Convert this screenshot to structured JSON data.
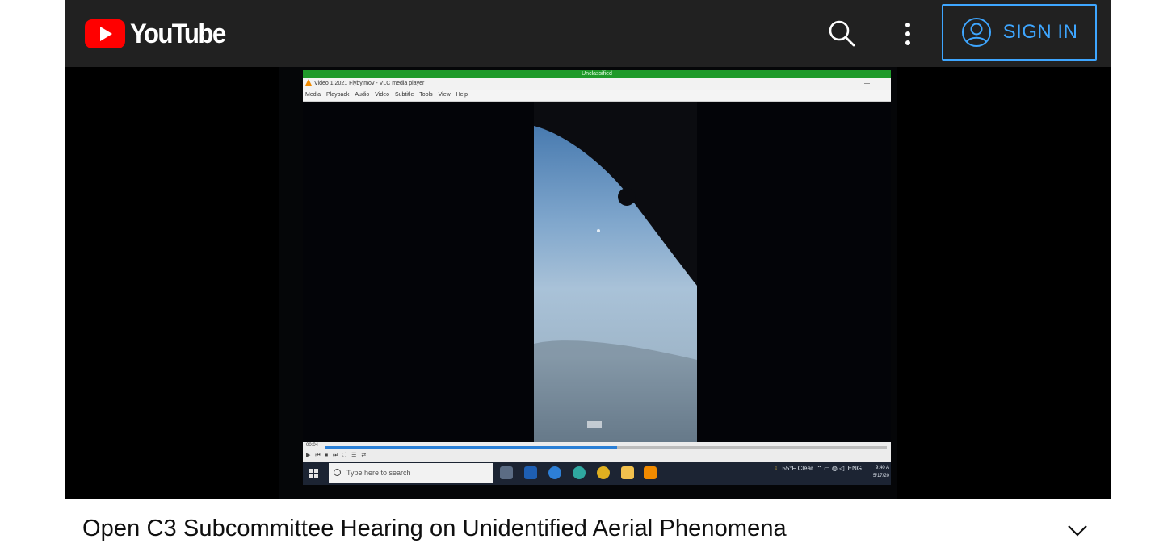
{
  "header": {
    "brand": "YouTube",
    "icons": {
      "search": "search-icon",
      "more": "more-vert-icon",
      "user": "account-circle-icon"
    },
    "sign_in_label": "SIGN IN",
    "colors": {
      "bar": "#212121",
      "brand_red": "#ff0000",
      "sign_in_blue": "#3ea6ff"
    }
  },
  "video_frame": {
    "classification_banner": "Unclassified",
    "player_window_title": "Video 1 2021 Flyby.mov - VLC media player",
    "player_menu": [
      "Media",
      "Playback",
      "Audio",
      "Video",
      "Subtitle",
      "Tools",
      "View",
      "Help"
    ],
    "elapsed_time": "00:04",
    "playback_progress": 0.52,
    "taskbar": {
      "search_placeholder": "Type here to search",
      "weather": "55°F Clear",
      "language": "ENG",
      "clock_time": "9:40 A",
      "clock_date": "5/17/20"
    }
  },
  "video": {
    "title": "Open C3 Subcommittee Hearing on Unidentified Aerial Phenomena",
    "expand_icon": "chevron-down-icon"
  }
}
